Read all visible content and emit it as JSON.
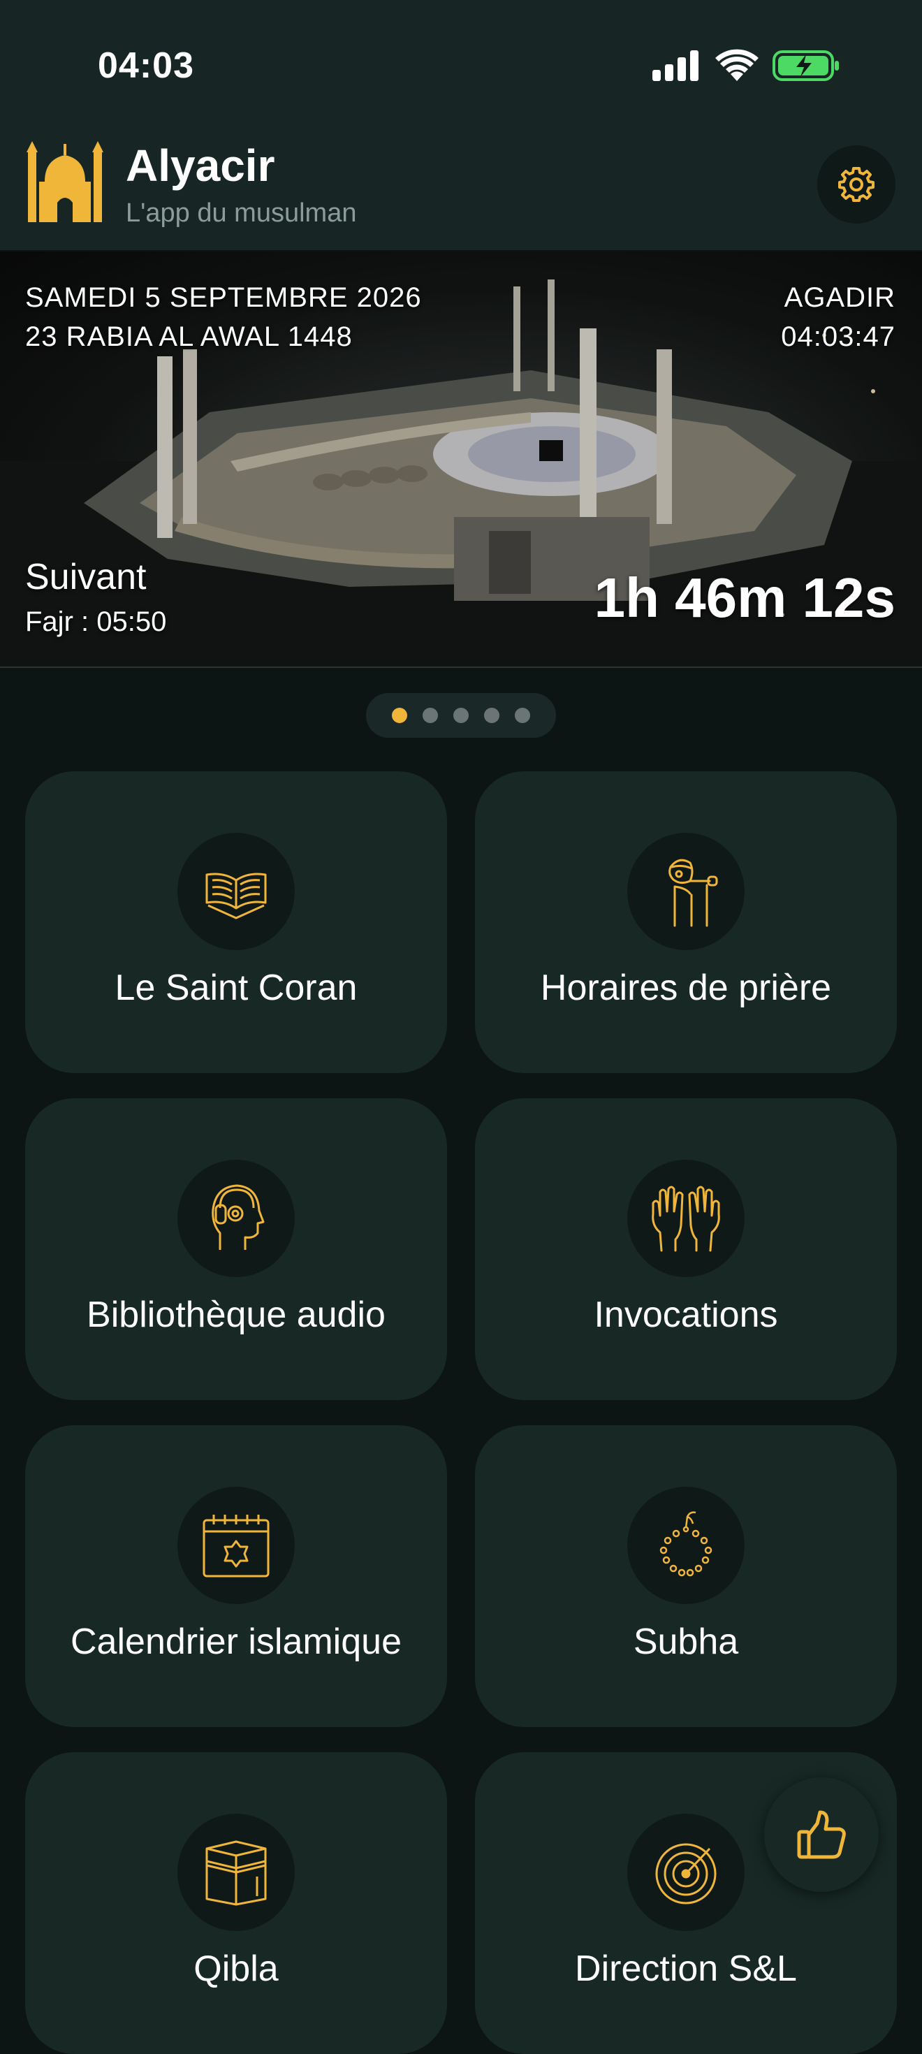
{
  "status_bar": {
    "time": "04:03"
  },
  "header": {
    "title": "Alyacir",
    "subtitle": "L'app du musulman",
    "logo_icon": "mosque-icon",
    "settings_icon": "gear-icon"
  },
  "banner": {
    "gregorian_date": "SAMEDI 5 SEPTEMBRE 2026",
    "hijri_date": "23 RABIA AL AWAL 1448",
    "city": "AGADIR",
    "clock": "04:03:47",
    "next_label": "Suivant",
    "next_prayer": "Fajr :  05:50",
    "countdown": "1h 46m 12s"
  },
  "pager": {
    "count": 5,
    "active_index": 0
  },
  "menu": [
    {
      "label": "Le Saint Coran",
      "icon": "open-quran-icon"
    },
    {
      "label": "Horaires de prière",
      "icon": "muezzin-icon"
    },
    {
      "label": "Bibliothèque audio",
      "icon": "headphones-head-icon"
    },
    {
      "label": "Invocations",
      "icon": "praying-hands-icon"
    },
    {
      "label": "Calendrier islamique",
      "icon": "calendar-star-icon"
    },
    {
      "label": "Subha",
      "icon": "prayer-beads-icon"
    },
    {
      "label": "Qibla",
      "icon": "kaaba-icon"
    },
    {
      "label": "Direction S&L",
      "icon": "radar-compass-icon"
    }
  ],
  "fab_icon": "thumbs-up-icon",
  "colors": {
    "accent": "#f0b63a",
    "card": "#172825",
    "background": "#0c1513",
    "header": "#172624"
  }
}
